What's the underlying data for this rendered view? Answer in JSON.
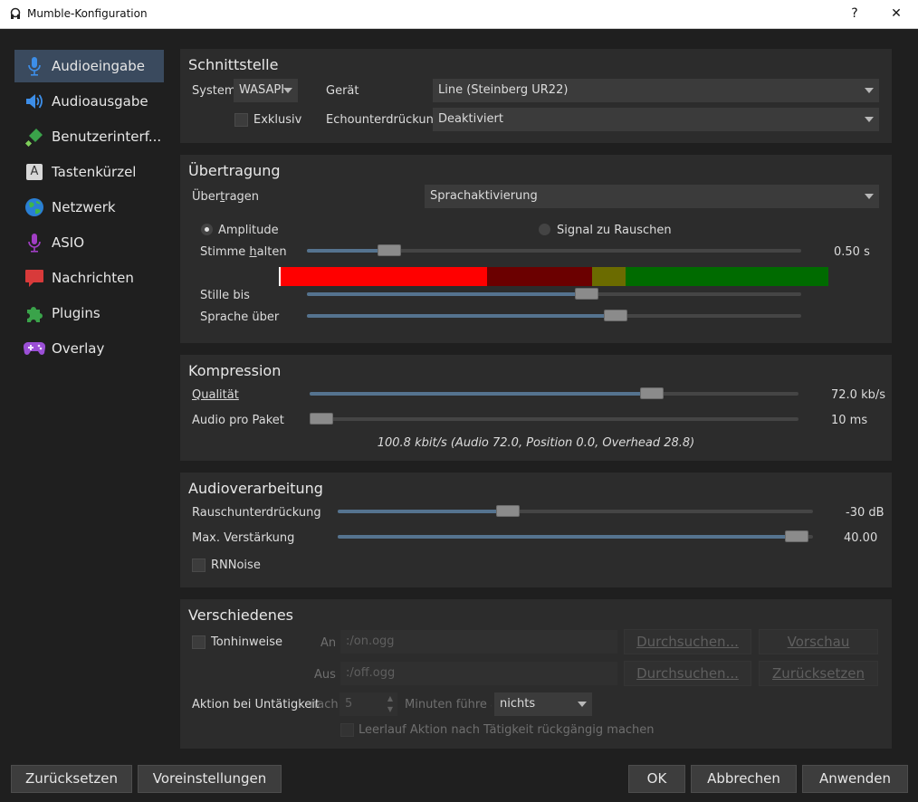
{
  "window": {
    "title": "Mumble-Konfiguration",
    "help_glyph": "?",
    "close_glyph": "✕"
  },
  "sidebar": {
    "items": [
      {
        "label": "Audioeingabe",
        "icon": "microphone-icon",
        "active": true
      },
      {
        "label": "Audioausgabe",
        "icon": "speaker-icon"
      },
      {
        "label": "Benutzerinterf...",
        "icon": "paintbrush-icon"
      },
      {
        "label": "Tastenkürzel",
        "icon": "keyboard-key-icon",
        "glyph": "A"
      },
      {
        "label": "Netzwerk",
        "icon": "globe-icon"
      },
      {
        "label": "ASIO",
        "icon": "asio-microphone-icon"
      },
      {
        "label": "Nachrichten",
        "icon": "speech-bubble-icon"
      },
      {
        "label": "Plugins",
        "icon": "puzzle-icon"
      },
      {
        "label": "Overlay",
        "icon": "gamepad-icon"
      }
    ]
  },
  "interface": {
    "title": "Schnittstelle",
    "system_label": "System",
    "system_value": "WASAPI",
    "device_label": "Gerät",
    "device_value": "Line (Steinberg UR22)",
    "exclusive_label": "Exklusiv",
    "echo_label": "Echounterdrückung",
    "echo_value": "Deaktiviert"
  },
  "transmission": {
    "title": "Übertragung",
    "transmit_label_pre": "Über",
    "transmit_label_u": "t",
    "transmit_label_post": "ragen",
    "transmit_value": "Sprachaktivierung",
    "amplitude_label": "Amplitude",
    "snr_label": "Signal zu Rauschen",
    "hold_label_pre": "Stimme ",
    "hold_label_u": "h",
    "hold_label_post": "alten",
    "hold_value": "0.50 s",
    "hold_level": 0.15,
    "silence_label": "Stille bis",
    "silence_level": 0.57,
    "speech_label": "Sprache über",
    "speech_level": 0.63,
    "meter_colors": [
      "#ff0000",
      "#6b0000",
      "#6b6b00",
      "#006b00"
    ]
  },
  "compression": {
    "title": "Kompression",
    "quality_label": "Qualität",
    "quality_value": "72.0 kb/s",
    "quality_level": 0.71,
    "packet_label": "Audio pro Paket",
    "packet_value": "10 ms",
    "packet_level": 0.0,
    "summary": "100.8 kbit/s (Audio 72.0, Position 0.0, Overhead 28.8)"
  },
  "processing": {
    "title": "Audioverarbeitung",
    "noise_label": "Rauschunterdrückung",
    "noise_value": "-30 dB",
    "noise_level": 0.35,
    "gain_label": "Max. Verstärkung",
    "gain_value": "40.00",
    "gain_level": 0.99,
    "rnnoise_label": "RNNoise"
  },
  "misc": {
    "title": "Verschiedenes",
    "cues_label": "Tonhinweise",
    "on_label": "An",
    "on_value": ":/on.ogg",
    "off_label": "Aus",
    "off_value": ":/off.ogg",
    "browse_label": "Durchsuchen...",
    "preview_label": "Vorschau",
    "reset_label": "Zurücksetzen",
    "idle_label": "Aktion bei Untätigkeit",
    "after_label": "nach",
    "minutes_value": "5",
    "minutes_label": "Minuten führe aus",
    "action_value": "nichts",
    "undo_label": "Leerlauf Aktion nach Tätigkeit rückgängig machen"
  },
  "footer": {
    "reset": "Zurücksetzen",
    "defaults": "Voreinstellungen",
    "ok": "OK",
    "cancel": "Abbrechen",
    "apply": "Anwenden"
  }
}
